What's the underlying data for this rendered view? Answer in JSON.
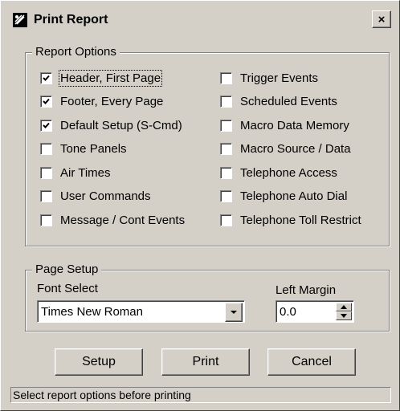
{
  "window": {
    "title": "Print Report",
    "icon": "printer-app-icon",
    "close_glyph": "×"
  },
  "report_options": {
    "label": "Report Options",
    "left": [
      {
        "label": "Header, First Page",
        "checked": true
      },
      {
        "label": "Footer, Every Page",
        "checked": true
      },
      {
        "label": "Default Setup (S-Cmd)",
        "checked": true
      },
      {
        "label": "Tone Panels",
        "checked": false
      },
      {
        "label": "Air Times",
        "checked": false
      },
      {
        "label": "User Commands",
        "checked": false
      },
      {
        "label": "Message / Cont Events",
        "checked": false
      }
    ],
    "right": [
      {
        "label": "Trigger Events",
        "checked": false
      },
      {
        "label": "Scheduled Events",
        "checked": false
      },
      {
        "label": "Macro Data Memory",
        "checked": false
      },
      {
        "label": "Macro Source / Data",
        "checked": false
      },
      {
        "label": "Telephone Access",
        "checked": false
      },
      {
        "label": "Telephone Auto Dial",
        "checked": false
      },
      {
        "label": "Telephone Toll Restrict",
        "checked": false
      }
    ]
  },
  "page_setup": {
    "label": "Page Setup",
    "font_label": "Font Select",
    "font_value": "Times New Roman",
    "margin_label": "Left Margin",
    "margin_value": "0.0"
  },
  "buttons": {
    "setup": "Setup",
    "print": "Print",
    "cancel": "Cancel"
  },
  "status": "Select report options before printing"
}
